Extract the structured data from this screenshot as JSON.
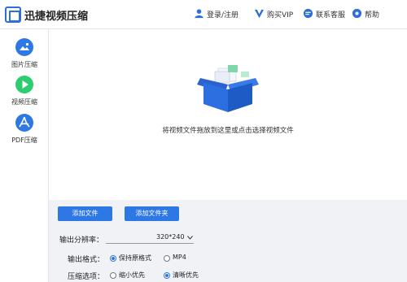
{
  "app": {
    "title": "迅捷视频压缩"
  },
  "header": {
    "login_label": "登录/注册",
    "buy_vip_label": "购买VIP",
    "support_label": "联系客服",
    "help_label": "帮助"
  },
  "sidebar": {
    "items": [
      {
        "label": "图片压缩",
        "icon": "image-icon"
      },
      {
        "label": "视频压缩",
        "icon": "play-icon"
      },
      {
        "label": "PDF压缩",
        "icon": "pdf-icon"
      }
    ],
    "active_index": 1
  },
  "dropzone": {
    "hint": "将视频文件拖放到这里或点击选择视频文件"
  },
  "actions": {
    "add_file_label": "添加文件",
    "add_folder_label": "添加文件夹"
  },
  "settings": {
    "resolution_label": "输出分辨率：",
    "resolution_value": "320*240",
    "format_label": "输出格式：",
    "format_options": [
      "保持原格式",
      "MP4"
    ],
    "format_selected": 0,
    "compress_label": "压缩选项：",
    "compress_options": [
      "缩小优先",
      "清晰优先"
    ],
    "compress_selected": 1
  },
  "colors": {
    "accent": "#2e78e6",
    "sidebar_active": "#2ecc71",
    "box_blue": "#2d6fe0"
  }
}
